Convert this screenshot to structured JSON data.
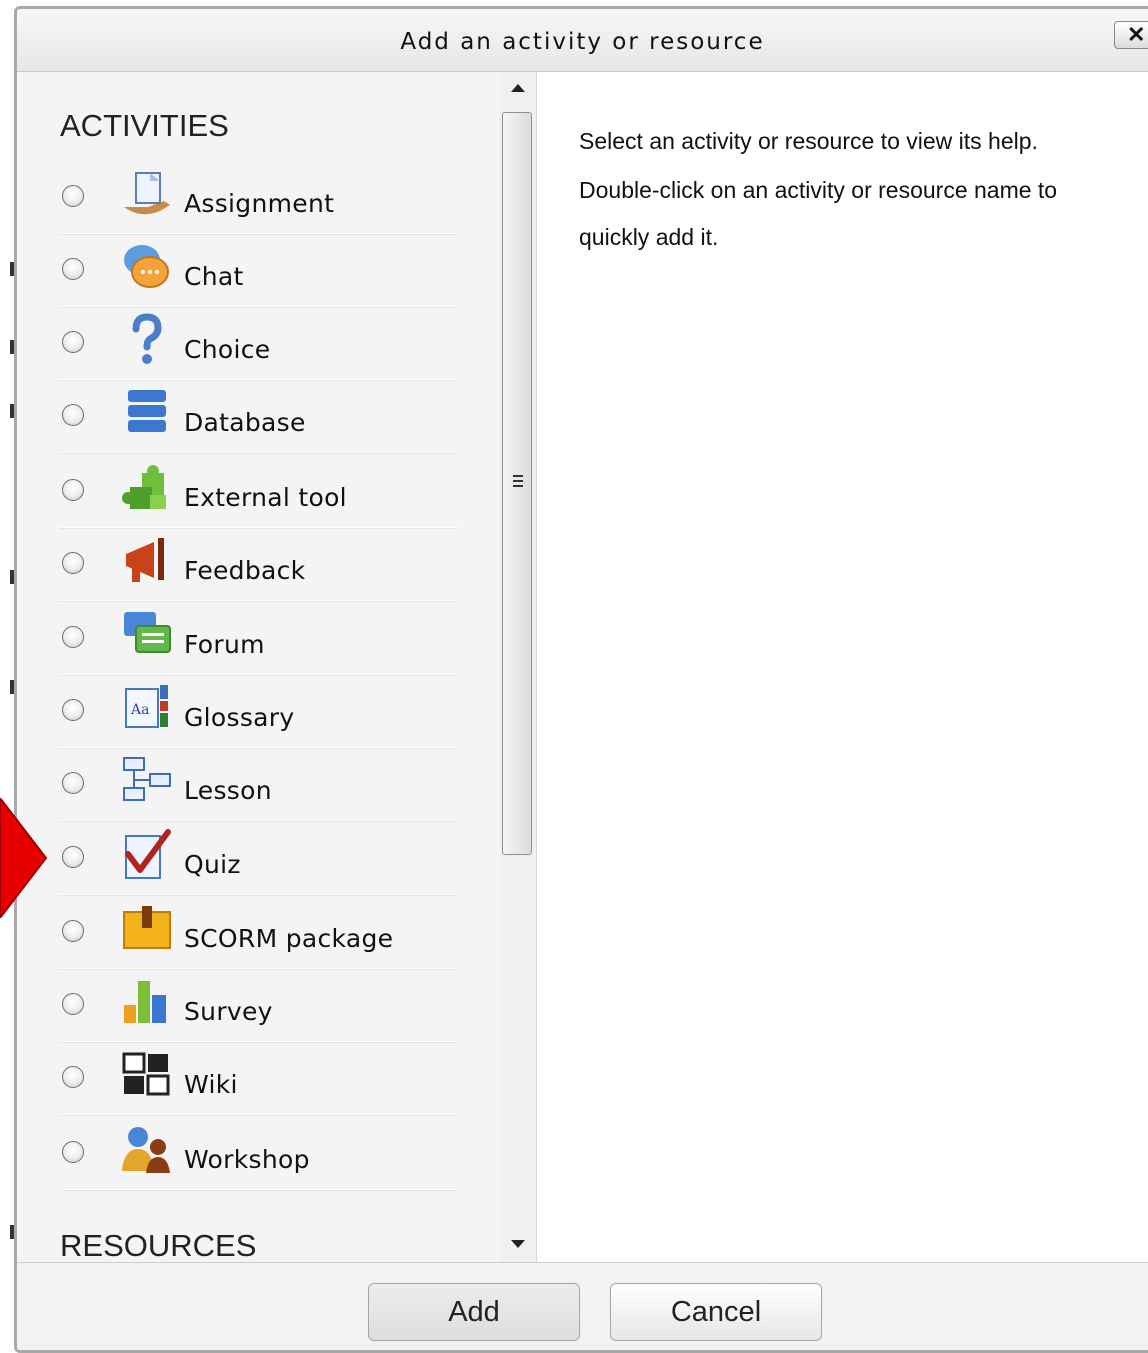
{
  "dialog": {
    "title": "Add an activity or resource",
    "close_label": "✕"
  },
  "activities_heading": "ACTIVITIES",
  "resources_heading": "RESOURCES",
  "activities": [
    {
      "label": "Assignment",
      "icon": "assignment-icon"
    },
    {
      "label": "Chat",
      "icon": "chat-icon"
    },
    {
      "label": "Choice",
      "icon": "question-mark-icon"
    },
    {
      "label": "Database",
      "icon": "database-icon"
    },
    {
      "label": "External tool",
      "icon": "puzzle-icon"
    },
    {
      "label": "Feedback",
      "icon": "megaphone-icon"
    },
    {
      "label": "Forum",
      "icon": "forum-icon"
    },
    {
      "label": "Glossary",
      "icon": "glossary-icon"
    },
    {
      "label": "Lesson",
      "icon": "lesson-icon"
    },
    {
      "label": "Quiz",
      "icon": "quiz-icon"
    },
    {
      "label": "SCORM package",
      "icon": "package-icon"
    },
    {
      "label": "Survey",
      "icon": "bar-chart-icon"
    },
    {
      "label": "Wiki",
      "icon": "wiki-icon"
    },
    {
      "label": "Workshop",
      "icon": "workshop-icon"
    }
  ],
  "help": {
    "line1": "Select an activity or resource to view its help.",
    "line2": "Double-click on an activity or resource name to",
    "line3": "quickly add it."
  },
  "footer": {
    "add_label": "Add",
    "cancel_label": "Cancel"
  },
  "colors": {
    "pointer_arrow": "#e60000"
  }
}
